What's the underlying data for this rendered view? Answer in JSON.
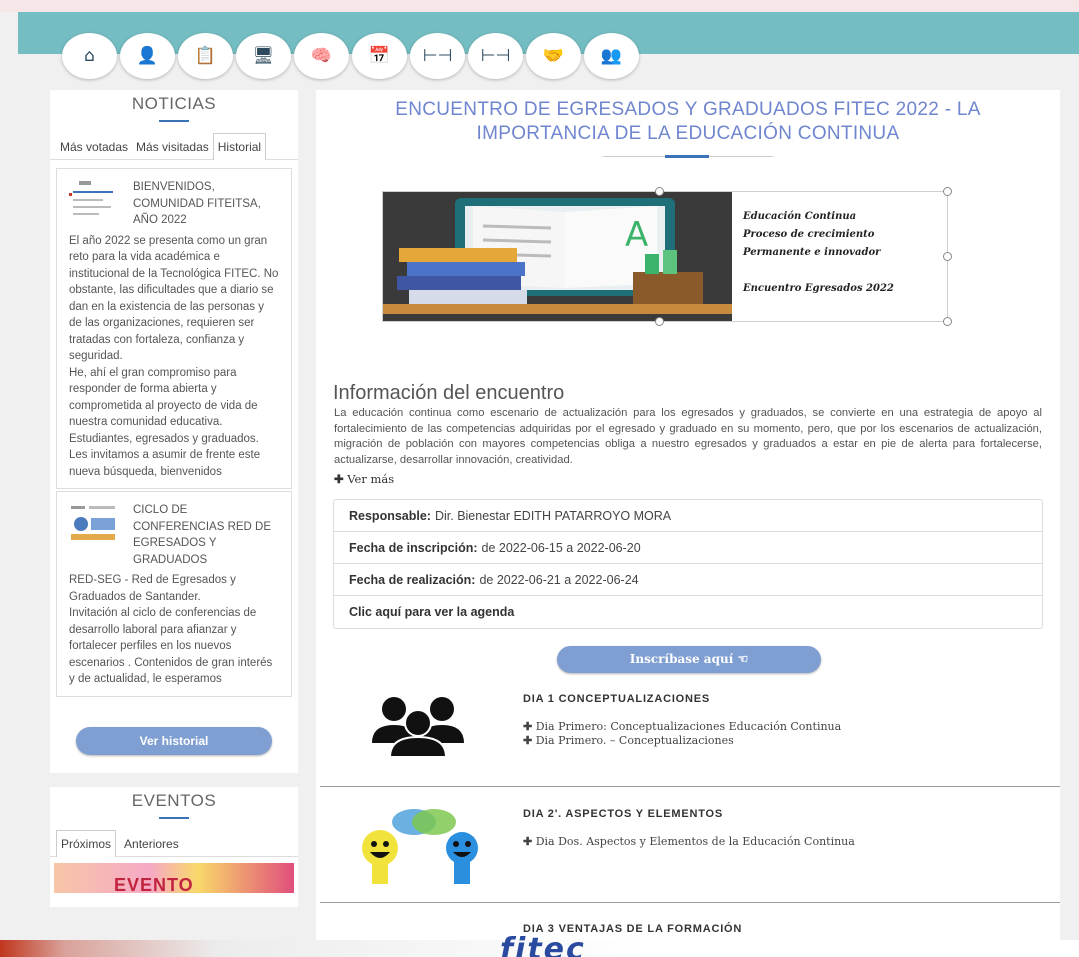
{
  "nav": {
    "icons": [
      "home-icon",
      "user-icon",
      "clipboard-icon",
      "monitor-icon",
      "idea-head-icon",
      "calendar-icon",
      "people-link-icon",
      "people-link-icon",
      "handshake-icon",
      "group-icon"
    ],
    "glyphs": [
      "⌂",
      "👤",
      "📋",
      "🖥",
      "🧠",
      "📅",
      "⊢⊣",
      "⊢⊣",
      "🤝",
      "👥"
    ]
  },
  "noticias": {
    "title": "NOTICIAS",
    "tabs": [
      "Más votadas",
      "Más visitadas",
      "Historial"
    ],
    "items": [
      {
        "title": "BIENVENIDOS, COMUNIDAD FITEITSA, AÑO 2022",
        "body": "El año 2022 se presenta como un gran reto para la vida académica e institucional de la Tecnológica FITEC.  No obstante, las dificultades que a diario se dan en la existencia de las personas y de las organizaciones, requieren ser tratadas con fortaleza, confianza y seguridad.\nHe, ahí el gran compromiso para responder de forma abierta y comprometida al proyecto de vida de nuestra comunidad educativa. Estudiantes, egresados y graduados.  Les invitamos a asumir de frente este nueva búsqueda, bienvenidos"
      },
      {
        "title": "CICLO DE CONFERENCIAS RED DE EGRESADOS Y GRADUADOS",
        "body": "RED-SEG - Red de Egresados y Graduados de Santander.\nInvitación al ciclo de conferencias de desarrollo laboral para afianzar y fortalecer  perfiles en los nuevos escenarios . Contenidos de gran interés y de actualidad, le esperamos"
      }
    ],
    "history_button": "Ver historial"
  },
  "eventos": {
    "title": "EVENTOS",
    "tabs": [
      "Próximos",
      "Anteriores"
    ],
    "image_text": "EVENTO"
  },
  "main": {
    "title": "ENCUENTRO DE EGRESADOS Y GRADUADOS FITEC 2022 - LA IMPORTANCIA DE LA EDUCACIÓN CONTINUA",
    "banner": {
      "lines": [
        "Educación Continua",
        "Proceso de crecimiento",
        "Permanente e innovador",
        "",
        "Encuentro Egresados 2022"
      ],
      "letter": "A"
    },
    "info_heading": "Información del encuentro",
    "info_text": "La educación continua como escenario de actualización para los egresados y graduados, se convierte en una estrategia de apoyo al fortalecimiento de las competencias adquiridas por el egresado y graduado en su momento, pero, que por los escenarios de actualización, migración de población con mayores competencias obliga a nuestro egresados y graduados a estar en pie de alerta para fortalecerse, actualizarse, desarrollar innovación, creatividad.",
    "ver_mas": "Ver más",
    "details": {
      "responsable_label": "Responsable:",
      "responsable_value": "Dir. Bienestar EDITH PATARROYO MORA",
      "inscripcion_label": "Fecha de inscripción:",
      "inscripcion_value": "de 2022-06-15 a 2022-06-20",
      "realizacion_label": "Fecha de realización:",
      "realizacion_value": "de 2022-06-21 a 2022-06-24",
      "agenda_link": "Clic aquí para ver la agenda"
    },
    "inscribase": "Inscríbase aquí",
    "days": [
      {
        "title": "DIA 1 CONCEPTUALIZACIONES",
        "items": [
          "Dia Primero: Conceptualizaciones Educación Continua",
          "Dia Primero. – Conceptualizaciones"
        ]
      },
      {
        "title": "DIA 2'. ASPECTOS Y ELEMENTOS",
        "items": [
          "Dia Dos. Aspectos y Elementos de la Educación Continua"
        ]
      },
      {
        "title": "DIA 3 VENTAJAS DE LA FORMACIÓN",
        "items": []
      }
    ]
  },
  "footer": {
    "logo_text": "fitec"
  },
  "colors": {
    "teal": "#74bdc2",
    "accent": "#3b73b9",
    "title_blue": "#6f86cf",
    "pill": "#7f9fd2"
  }
}
